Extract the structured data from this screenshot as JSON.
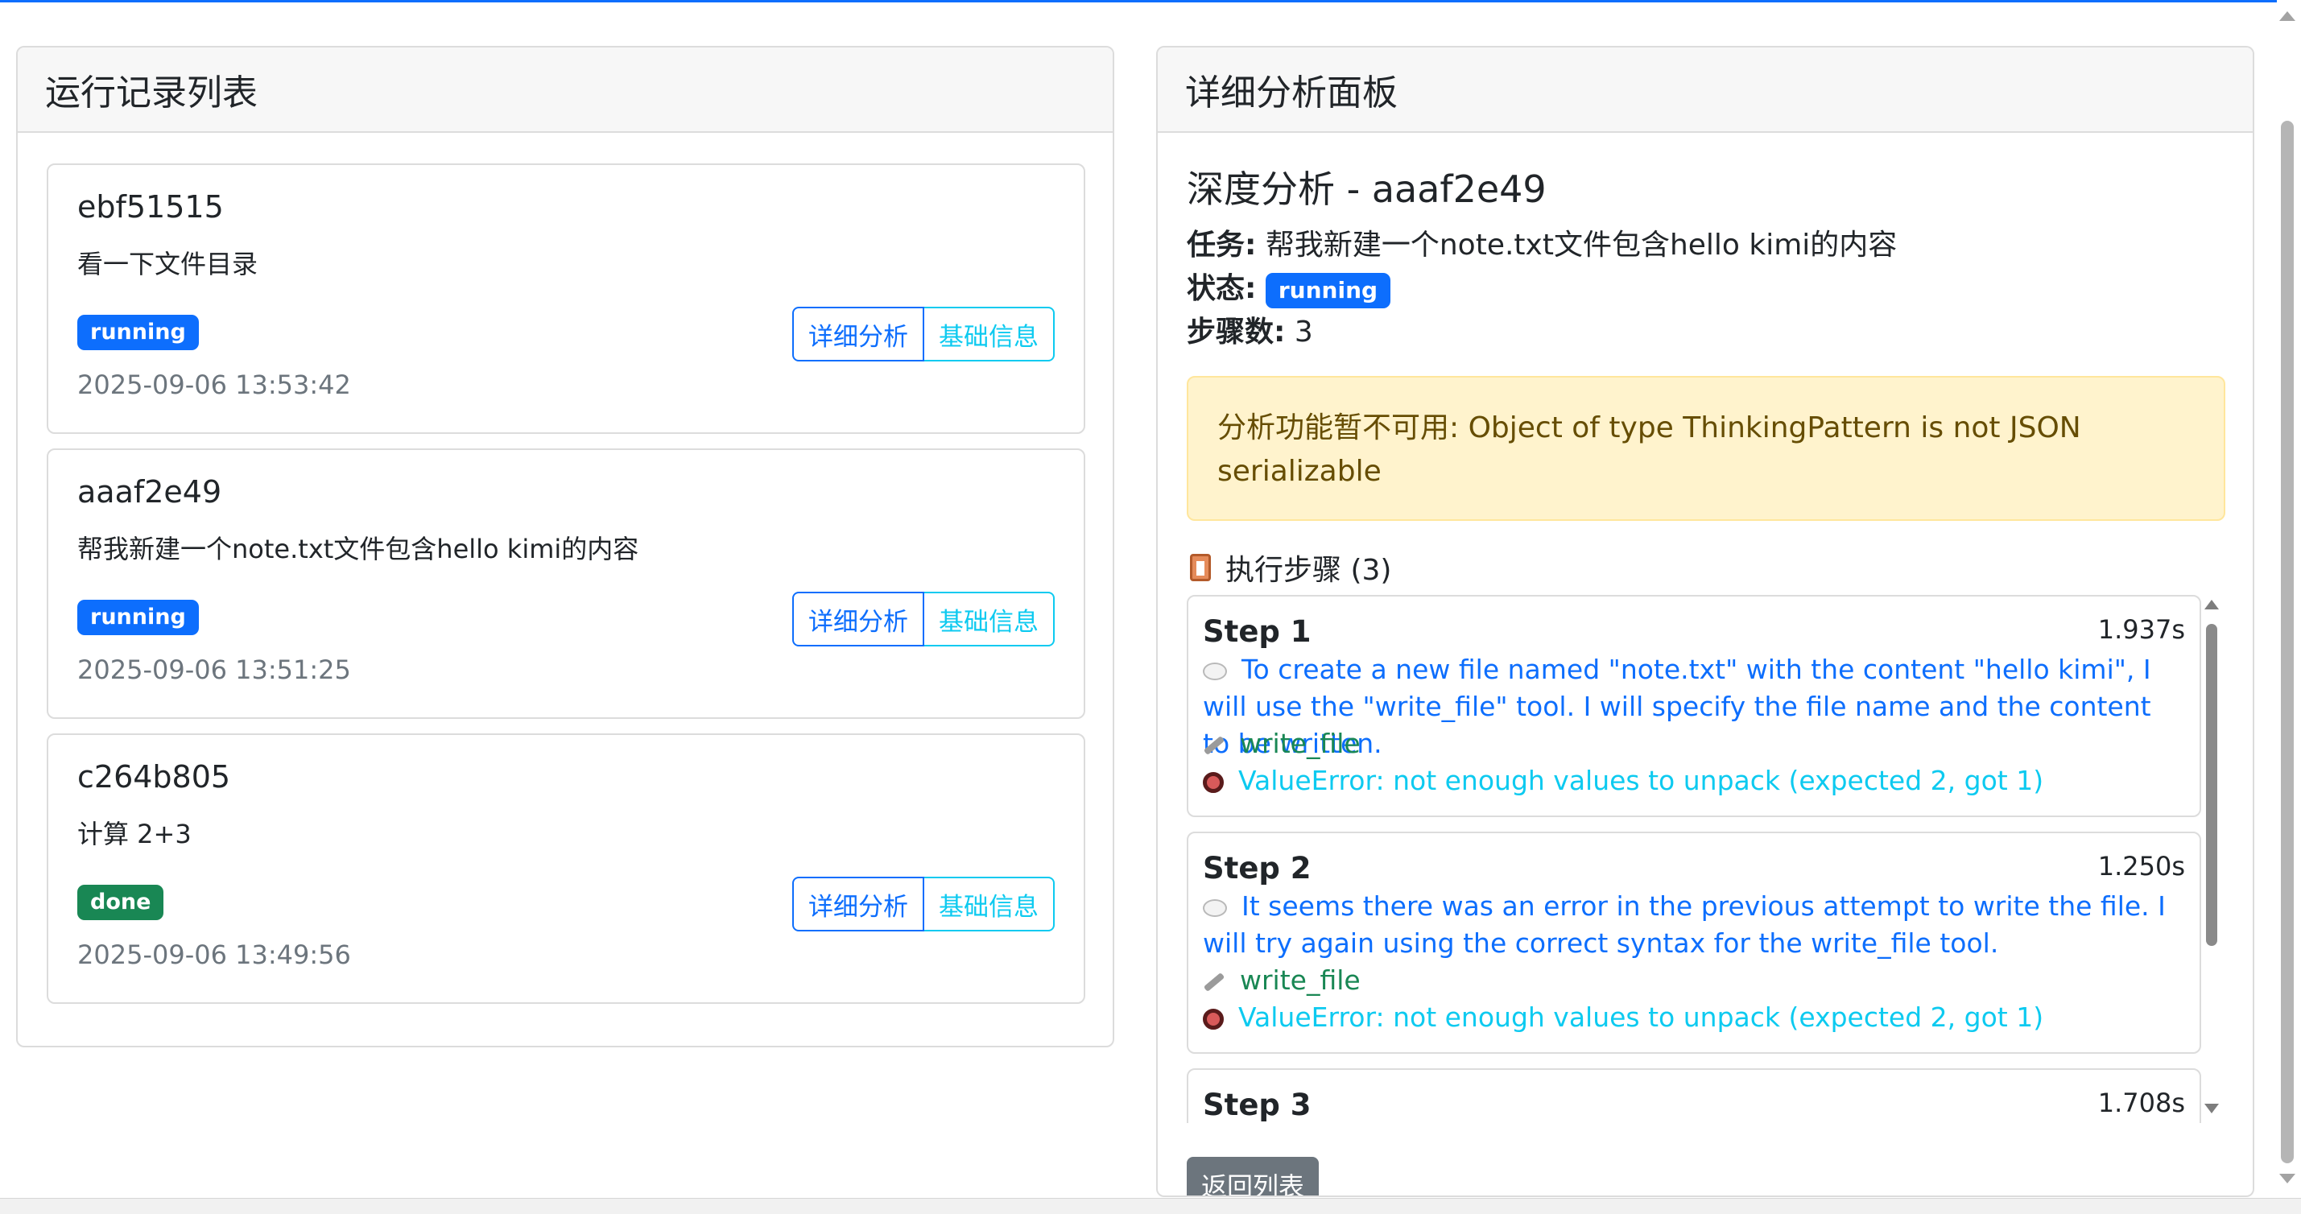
{
  "left_panel": {
    "title": "运行记录列表",
    "runs": [
      {
        "id": "ebf51515",
        "task": "看一下文件目录",
        "status": "running",
        "time": "2025-09-06 13:53:42",
        "detail_label": "详细分析",
        "basic_label": "基础信息"
      },
      {
        "id": "aaaf2e49",
        "task": "帮我新建一个note.txt文件包含hello kimi的内容",
        "status": "running",
        "time": "2025-09-06 13:51:25",
        "detail_label": "详细分析",
        "basic_label": "基础信息"
      },
      {
        "id": "c264b805",
        "task": "计算 2+3",
        "status": "done",
        "time": "2025-09-06 13:49:56",
        "detail_label": "详细分析",
        "basic_label": "基础信息"
      }
    ]
  },
  "right_panel": {
    "title": "详细分析面板",
    "heading": "深度分析 - aaaf2e49",
    "task_label": "任务:",
    "task_value": "帮我新建一个note.txt文件包含hello kimi的内容",
    "status_label": "状态:",
    "status_value": "running",
    "steps_count_label": "步骤数:",
    "steps_count_value": "3",
    "alert": "分析功能暂不可用: Object of type ThinkingPattern is not JSON serializable",
    "steps_heading": "执行步骤 (3)",
    "steps": [
      {
        "title": "Step 1",
        "duration": "1.937s",
        "thought": "To create a new file named \"note.txt\" with the content \"hello kimi\", I will use the \"write_file\" tool. I will specify the file name and the content to be written.",
        "tool": "write_file",
        "error": "ValueError: not enough values to unpack (expected 2, got 1)"
      },
      {
        "title": "Step 2",
        "duration": "1.250s",
        "thought": "It seems there was an error in the previous attempt to write the file. I will try again using the correct syntax for the write_file tool.",
        "tool": "write_file",
        "error": "ValueError: not enough values to unpack (expected 2, got 1)"
      },
      {
        "title": "Step 3",
        "duration": "1.708s"
      }
    ],
    "back_label": "返回列表"
  },
  "icons": {
    "steps": "clipboard-icon",
    "thought": "thought-bubble-icon",
    "tool": "wrench-icon",
    "error": "eye-icon"
  },
  "colors": {
    "primary": "#0d6efd",
    "info": "#0dcaf0",
    "success": "#198754",
    "warning_bg": "#fff3cd",
    "secondary": "#6c757d"
  }
}
